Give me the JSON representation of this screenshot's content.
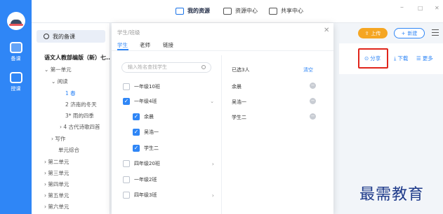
{
  "rail": {
    "items": [
      {
        "label": "备课",
        "icon": "book-icon"
      },
      {
        "label": "授课",
        "icon": "teach-icon"
      }
    ]
  },
  "topbar": {
    "tabs": [
      {
        "label": "我的资源",
        "icon": "folder-icon"
      },
      {
        "label": "资源中心",
        "icon": "monitor-icon"
      },
      {
        "label": "共享中心",
        "icon": "share-icon"
      }
    ],
    "window_min": "–",
    "window_max": "□",
    "window_close": "✕"
  },
  "sidebar": {
    "my_prep": "我的备课",
    "tree": [
      {
        "label": "语文人教部编版（新）七...",
        "kind": "book"
      },
      {
        "label": "第一单元",
        "prefix": "⌄"
      },
      {
        "label": "阅读",
        "prefix": "⌄"
      },
      {
        "label": "1 春",
        "kind": "sel"
      },
      {
        "label": "2 济南的冬天"
      },
      {
        "label": "3* 雨的四季"
      },
      {
        "label": "4 古代诗歌四首",
        "prefix": "›"
      },
      {
        "label": "写作",
        "prefix": "›"
      },
      {
        "label": "单元综合"
      },
      {
        "label": "第二单元",
        "prefix": "›"
      },
      {
        "label": "第三单元",
        "prefix": "›"
      },
      {
        "label": "第四单元",
        "prefix": "›"
      },
      {
        "label": "第五单元",
        "prefix": "›"
      },
      {
        "label": "第六单元",
        "prefix": "›"
      }
    ]
  },
  "toolbar": {
    "upload": "上传",
    "new": "新建"
  },
  "actions": {
    "share": "分享",
    "download": "下载",
    "more": "更多"
  },
  "dialog": {
    "title": "学生/班级",
    "close": "✕",
    "tabs": [
      "学生",
      "老师",
      "链接"
    ],
    "search_placeholder": "输入姓名查找学生",
    "classes": [
      {
        "label": "一年级10班",
        "checked": false,
        "indent": false
      },
      {
        "label": "一年级4班",
        "checked": true,
        "indent": false,
        "expand": "⌄"
      },
      {
        "label": "余晨",
        "checked": true,
        "indent": true
      },
      {
        "label": "吴浩一",
        "checked": true,
        "indent": true
      },
      {
        "label": "学生二",
        "checked": true,
        "indent": true
      },
      {
        "label": "四年级20班",
        "checked": false,
        "indent": false,
        "arrow": "›"
      },
      {
        "label": "一年级2班",
        "checked": false,
        "indent": false
      },
      {
        "label": "四年级3班",
        "checked": false,
        "indent": false,
        "arrow": "›"
      }
    ],
    "selected_header": "已选3人",
    "clear": "清空",
    "selected": [
      "余晨",
      "吴浩一",
      "学生二"
    ]
  },
  "watermark": "最需教育",
  "colors": {
    "primary": "#2f86f6",
    "upload": "#f5a623",
    "highlight": "#e0251b"
  }
}
